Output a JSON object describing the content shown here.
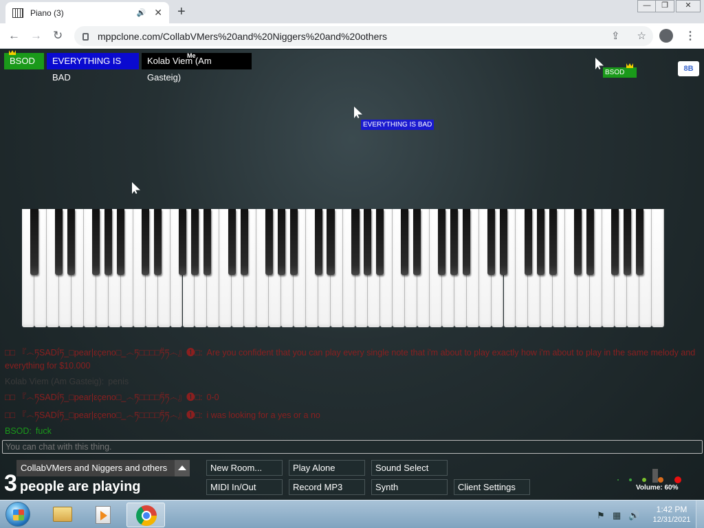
{
  "browser": {
    "tab_title": "Piano (3)",
    "tab_close": "✕",
    "new_tab": "+",
    "url": "mppclone.com/CollabVMers%20and%20Niggers%20and%20others",
    "back_glyph": "←",
    "forward_glyph": "→",
    "reload_glyph": "↻",
    "share_glyph": "⇪",
    "star_glyph": "☆",
    "menu_glyph": "⋮",
    "win_min": "—",
    "win_restore": "❐",
    "win_close": "✕"
  },
  "users": [
    {
      "name": "BSOD",
      "color": "#1a9a1a",
      "crown": true
    },
    {
      "name": "EVERYTHING IS BAD",
      "color": "#0a0ad0",
      "crown": false
    },
    {
      "name": "Kolab Viem (Am Gasteig)",
      "color": "#000000",
      "crown": false
    }
  ],
  "me_label": "Me",
  "cursors": [
    {
      "name": "BSOD",
      "color": "#1a9a1a",
      "crown": true
    },
    {
      "name": "EVERYTHING IS BAD",
      "color": "#1a1ad0",
      "crown": false
    }
  ],
  "bb_button": "8B",
  "chat": {
    "messages": [
      {
        "name": "□□ 『෴ཏSADḯཏ_□pear|εçeno□_෴ཏ□□□□ཏ̈ཏ෴』❶□:",
        "text": "Are you confident that you can play every single note that i'm about to play exactly how i'm about to play in the same melody and everything for $10.000",
        "color": "#8c1f1f"
      },
      {
        "name": "Kolab Viem (Am Gasteig):",
        "text": "penis",
        "color": "#3a3a3a"
      },
      {
        "name": "□□ 『෴ཏSADḯཏ_□pear|εçeno□_෴ཏ□□□□ཏ̈ཏ෴』❶□:",
        "text": "0-0",
        "color": "#8c1f1f"
      },
      {
        "name": "□□ 『෴ཏSADḯཏ_□pear|εçeno□_෴ཏ□□□□ཏ̈ཏ෴』❶□:",
        "text": "i was looking for a yes or a no",
        "color": "#8c1f1f"
      },
      {
        "name": "BSOD:",
        "text": "fuck",
        "color": "#1a9a1a"
      }
    ],
    "input_placeholder": "You can chat with this thing."
  },
  "room": {
    "name": "CollabVMers and Niggers and others",
    "count": "3",
    "count_text": "people are playing"
  },
  "buttons": {
    "new_room": "New Room...",
    "play_alone": "Play Alone",
    "sound_select": "Sound Select",
    "midi": "MIDI In/Out",
    "record_mp3": "Record MP3",
    "synth": "Synth",
    "client_settings": "Client Settings"
  },
  "volume": {
    "label": "Volume: 60%",
    "level": 0.6
  },
  "taskbar": {
    "time": "1:42 PM",
    "date": "12/31/2021"
  }
}
